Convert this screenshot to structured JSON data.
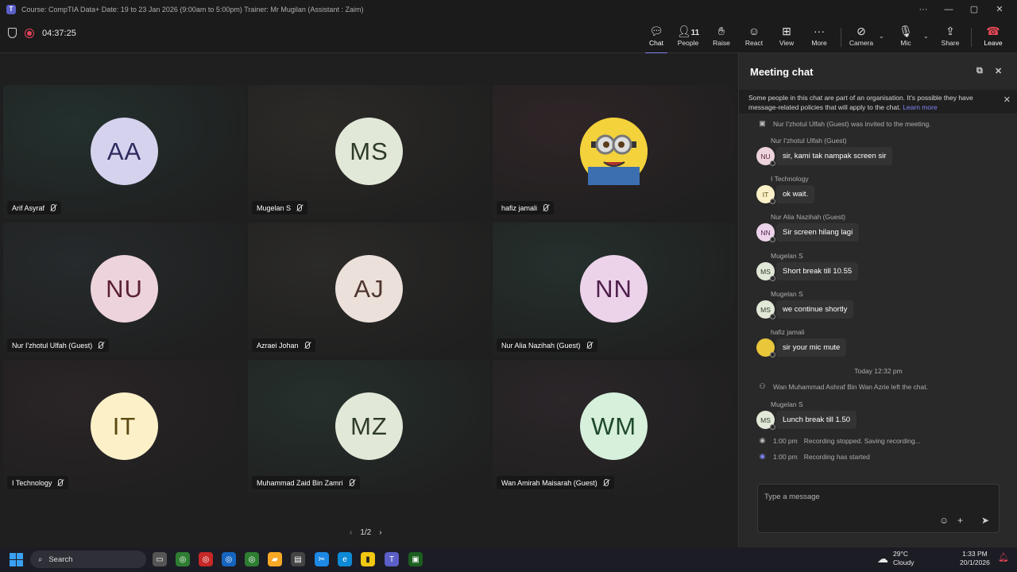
{
  "window": {
    "title": "Course: CompTIA Data+ Date: 19 to 23 Jan 2026 (9:00am to 5:00pm) Trainer: Mr Mugilan (Assistant : Zaim)"
  },
  "toolbar": {
    "timer": "04:37:25",
    "chat": "Chat",
    "people": "People",
    "people_count": "11",
    "raise": "Raise",
    "react": "React",
    "view": "View",
    "more": "More",
    "camera": "Camera",
    "mic": "Mic",
    "share": "Share",
    "leave": "Leave"
  },
  "colors": {
    "accent": "#7f85f5",
    "record": "#e3445a",
    "leave": "#e74856"
  },
  "participants": [
    {
      "initials": "AA",
      "name": "Arif Asyraf",
      "avatar_bg": "#d5d2ee",
      "avatar_fg": "#2e2b5f"
    },
    {
      "initials": "MS",
      "name": "Mugelan S",
      "avatar_bg": "#e2e8d8",
      "avatar_fg": "#2e3b28"
    },
    {
      "initials": "",
      "name": "hafiz jamali",
      "avatar_bg": "#e9c63a",
      "avatar_fg": "#333"
    },
    {
      "initials": "NU",
      "name": "Nur I'zhotul Ulfah (Guest)",
      "avatar_bg": "#edd3dc",
      "avatar_fg": "#5a1f33"
    },
    {
      "initials": "AJ",
      "name": "Azraei Johan",
      "avatar_bg": "#ece0da",
      "avatar_fg": "#4f3530"
    },
    {
      "initials": "NN",
      "name": "Nur Alia Nazihah (Guest)",
      "avatar_bg": "#ecd3ea",
      "avatar_fg": "#4f1f4c"
    },
    {
      "initials": "IT",
      "name": "I Technology",
      "avatar_bg": "#fbf0c8",
      "avatar_fg": "#5c4a12"
    },
    {
      "initials": "MZ",
      "name": "Muhammad Zaid Bin Zamri",
      "avatar_bg": "#e2e8d8",
      "avatar_fg": "#2e3b28"
    },
    {
      "initials": "WM",
      "name": "Wan Amirah Maisarah (Guest)",
      "avatar_bg": "#d6f0dc",
      "avatar_fg": "#1f4a2b"
    }
  ],
  "pager": {
    "label": "1/2"
  },
  "chat": {
    "title": "Meeting chat",
    "notice": "Some people in this chat are part of an organisation. It's possible they have message-related policies that will apply to the chat.",
    "learn_more": "Learn more",
    "system_invited": "Nur I'zhotul Ulfah (Guest) was invited to the meeting.",
    "messages": [
      {
        "sender": "Nur I'zhotul Ulfah (Guest)",
        "initials": "NU",
        "text": "sir, kami tak nampak screen sir",
        "bg": "#edd3dc",
        "fg": "#5a1f33"
      },
      {
        "sender": "I Technology",
        "initials": "IT",
        "text": "ok wait.",
        "bg": "#fbf0c8",
        "fg": "#5c4a12"
      },
      {
        "sender": "Nur Alia Nazihah (Guest)",
        "initials": "NN",
        "text": "Sir screen hilang lagi",
        "bg": "#ecd3ea",
        "fg": "#4f1f4c"
      },
      {
        "sender": "Mugelan S",
        "initials": "MS",
        "text": "Short break till 10.55",
        "bg": "#e2e8d8",
        "fg": "#2e3b28"
      },
      {
        "sender": "Mugelan S",
        "initials": "MS",
        "text": "we continue shortly",
        "bg": "#e2e8d8",
        "fg": "#2e3b28"
      },
      {
        "sender": "hafiz jamali",
        "initials": "",
        "text": "sir your mic mute",
        "bg": "#e9c63a",
        "fg": "#333"
      }
    ],
    "date_separator": "Today 12:32 pm",
    "system_left": "Wan Muhammad Ashraf Bin Wan Azrie left the chat.",
    "last_message": {
      "sender": "Mugelan S",
      "initials": "MS",
      "text": "Lunch break till 1.50"
    },
    "rec_stopped": {
      "time": "1:00 pm",
      "text": "Recording stopped. Saving recording..."
    },
    "rec_started": {
      "time": "1:00 pm",
      "text": "Recording has started"
    },
    "compose_placeholder": "Type a message"
  },
  "taskbar": {
    "search": "Search",
    "weather_temp": "29°C",
    "weather_desc": "Cloudy",
    "time": "1:33 PM",
    "date": "20/1/2026"
  }
}
